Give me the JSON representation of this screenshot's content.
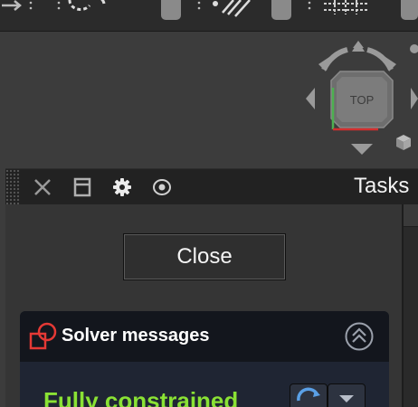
{
  "navcube": {
    "face_label": "TOP"
  },
  "dock": {
    "title": "Tasks"
  },
  "task_panel": {
    "close_label": "Close",
    "solver": {
      "title": "Solver messages",
      "status": "Fully constrained",
      "status_color": "#8ae234"
    }
  },
  "icons": {
    "toolbar": [
      "arrow-right-icon",
      "dotted-circle-icon",
      "line-tool-icon",
      "array-tool-icon"
    ],
    "dock": [
      "close-icon",
      "float-icon",
      "gear-icon",
      "eye-icon"
    ],
    "solver": [
      "solver-messages-icon",
      "collapse-up-icon",
      "refresh-icon",
      "dropdown-icon"
    ]
  }
}
